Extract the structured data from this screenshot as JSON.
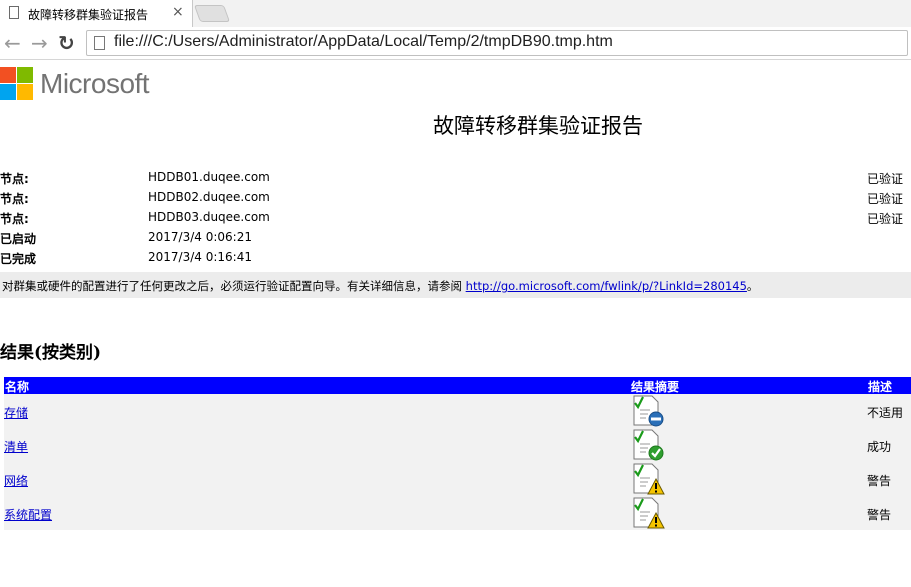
{
  "browser": {
    "tab_title": "故障转移群集验证报告",
    "close_glyph": "×",
    "back_glyph": "←",
    "forward_glyph": "→",
    "reload_glyph": "↻",
    "url": "file:///C:/Users/Administrator/AppData/Local/Temp/2/tmpDB90.tmp.htm"
  },
  "logo": {
    "text": "Microsoft",
    "colors": [
      "#f25022",
      "#7fba00",
      "#00a4ef",
      "#ffb900"
    ]
  },
  "report": {
    "title": "故障转移群集验证报告",
    "nodes": [
      {
        "label": "节点:",
        "value": "HDDB01.duqee.com",
        "status": "已验证"
      },
      {
        "label": "节点:",
        "value": "HDDB02.duqee.com",
        "status": "已验证"
      },
      {
        "label": "节点:",
        "value": "HDDB03.duqee.com",
        "status": "已验证"
      }
    ],
    "started_label": "已启动",
    "started_value": "2017/3/4 0:06:21",
    "completed_label": "已完成",
    "completed_value": "2017/3/4 0:16:41",
    "notice_text": "对群集或硬件的配置进行了任何更改之后，必须运行验证配置向导。有关详细信息，请参阅 ",
    "notice_link": "http://go.microsoft.com/fwlink/p/?LinkId=280145",
    "notice_end": "。"
  },
  "results": {
    "heading": "结果(按类别)",
    "columns": [
      "名称",
      "结果摘要",
      "描述"
    ],
    "header_color": "#0000ff",
    "rows": [
      {
        "name": "存储",
        "status_icon": "not-applicable-icon",
        "description": "不适用"
      },
      {
        "name": "清单",
        "status_icon": "success-icon",
        "description": "成功"
      },
      {
        "name": "网络",
        "status_icon": "warning-icon",
        "description": "警告"
      },
      {
        "name": "系统配置",
        "status_icon": "warning-icon",
        "description": "警告"
      }
    ]
  }
}
